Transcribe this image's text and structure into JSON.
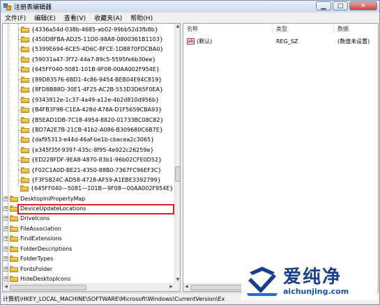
{
  "window": {
    "title": "注册表编辑器",
    "minimize_label": "▁",
    "maximize_label": "□",
    "close_label": "✕"
  },
  "menu": [
    "文件(F)",
    "编辑(E)",
    "查看(V)",
    "收藏夹(A)",
    "帮助(H)"
  ],
  "tree": {
    "guid_items": [
      "{4336a54d-038b-4685-ab02-99bb52d3fb8b}",
      "{450D8FBA-AD25-11D0-98A8-0800361B1103}",
      "{5399E694-6CE5-4D6C-8FCE-1D8870FDCBA0}",
      "{59031a47-3f72-44a7-89c5-5595fe6b30ee}",
      "{645FF040-5081-101B-9F08-00AA002F954E}",
      "{89D83576-6BD1-4c86-9454-BEB04E94C819}",
      "{8FD8B88D-30E1-4F25-AC2B-553D3D65F0EA}",
      "{9343812e-1c37-4a49-a12e-4b2d810d956b}",
      "{B4FB3F98-C1EA-428d-A78A-D1F5659CBA93}",
      "{B5EAD1DB-7C18-4954-8820-01733BC08C82}",
      "{BD7A2E7B-21CB-41b2-A086-B309680C6B7E}",
      "{daf95313-e44d-46af-be1b-cbacea2c3065}",
      "{e345f35f-9397-435c-8f95-4e922c26259e}",
      "{ED228FDF-9EA8-4870-83b1-96b02CFE0D52}",
      "{F02C1A0D-BE21-4350-88B0-7367FC96EF3C}",
      "{F3F5824C-AD58-4728-AF59-A1EBE3392799}"
    ],
    "new_key": "{645FF040—5081—101B—9F08—00AA002F954E}",
    "sibling_items": [
      "DesktopIniPropertyMap",
      "DeviceUpdateLocations",
      "DriveIcons",
      "FileAssociation",
      "FindExtensions",
      "FolderDescriptions",
      "FolderTypes",
      "FontsFolder",
      "HideDesktopIcons"
    ]
  },
  "list": {
    "headers": {
      "name": "名称",
      "type": "类型",
      "data": "数据"
    },
    "rows": [
      {
        "icon": "ab",
        "name": "(默认)",
        "type": "REG_SZ",
        "data": "(数值未设置)"
      }
    ]
  },
  "status": {
    "path": "计算机\\HKEY_LOCAL_MACHINE\\SOFTWARE\\Microsoft\\Windows\\CurrentVersion\\Ex"
  },
  "watermark": {
    "title": "爱纯净",
    "url": "aichunjing.com"
  },
  "colors": {
    "highlight_border": "#e0182a",
    "folder": "#f0c040",
    "watermark_blue": "#1a3f8a"
  }
}
